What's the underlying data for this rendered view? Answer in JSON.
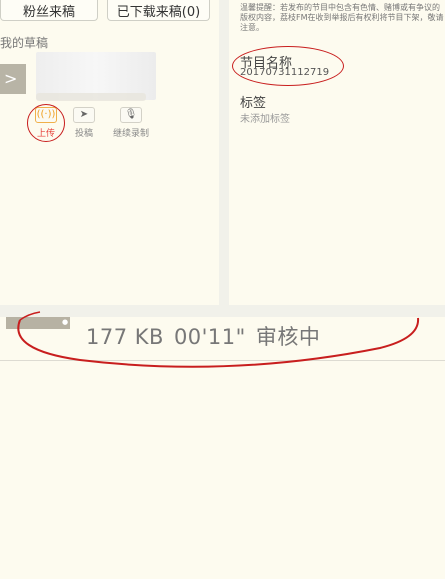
{
  "left_panel": {
    "tabs": [
      {
        "label": "粉丝来稿"
      },
      {
        "label": "已下载来稿(0)"
      }
    ],
    "section_title": "我的草稿",
    "thumb_glyph": ">",
    "actions": [
      {
        "label": "上传",
        "icon": "upload-icon",
        "glyph": "((·))"
      },
      {
        "label": "投稿",
        "icon": "send-icon",
        "glyph": "➤"
      },
      {
        "label": "继续录制",
        "icon": "mic-icon",
        "glyph": "🎙"
      }
    ]
  },
  "right_panel": {
    "notice": "温馨提醒：若发布的节目中包含有色情、赌博或有争议的版权内容，荔枝FM在收到举报后有权利将节目下架，敬请注意。",
    "program_name": {
      "label": "节目名称",
      "value": "20170731112719"
    },
    "tags": {
      "label": "标签",
      "value": "未添加标签"
    }
  },
  "draft_row": {
    "size": "177 KB",
    "duration": "00'11\"",
    "status": "审核中"
  },
  "colors": {
    "annotation": "#c81e1e",
    "background": "#fdfbef",
    "accent": "#e6403a"
  }
}
